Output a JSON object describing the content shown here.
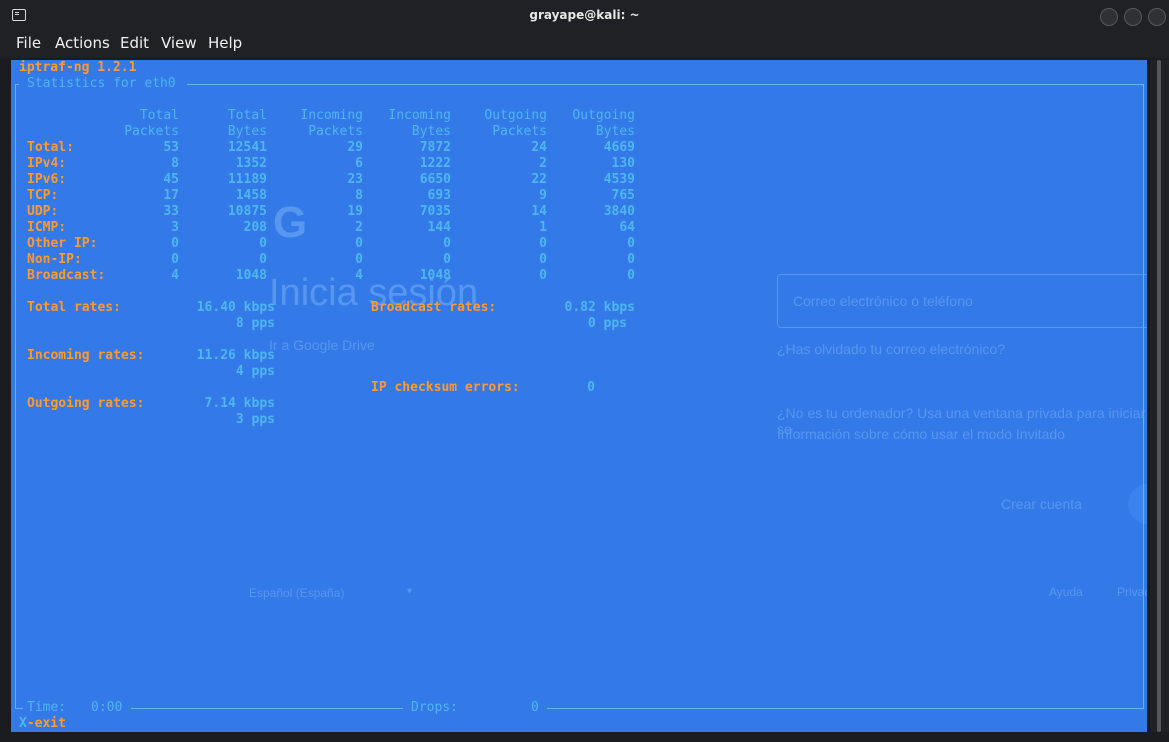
{
  "window": {
    "title": "grayape@kali: ~"
  },
  "menu": [
    "File",
    "Actions",
    "Edit",
    "View",
    "Help"
  ],
  "app": {
    "name": "iptraf-ng 1.2.1",
    "panel_title": "Statistics for eth0"
  },
  "table": {
    "headers": [
      [
        "Total",
        "Packets"
      ],
      [
        "Total",
        "Bytes"
      ],
      [
        "Incoming",
        "Packets"
      ],
      [
        "Incoming",
        "Bytes"
      ],
      [
        "Outgoing",
        "Packets"
      ],
      [
        "Outgoing",
        "Bytes"
      ]
    ],
    "rows": [
      {
        "label": "Total:",
        "values": [
          "53",
          "12541",
          "29",
          "7872",
          "24",
          "4669"
        ]
      },
      {
        "label": "IPv4:",
        "values": [
          "8",
          "1352",
          "6",
          "1222",
          "2",
          "130"
        ]
      },
      {
        "label": "IPv6:",
        "values": [
          "45",
          "11189",
          "23",
          "6650",
          "22",
          "4539"
        ]
      },
      {
        "label": "TCP:",
        "values": [
          "17",
          "1458",
          "8",
          "693",
          "9",
          "765"
        ]
      },
      {
        "label": "UDP:",
        "values": [
          "33",
          "10875",
          "19",
          "7035",
          "14",
          "3840"
        ]
      },
      {
        "label": "ICMP:",
        "values": [
          "3",
          "208",
          "2",
          "144",
          "1",
          "64"
        ]
      },
      {
        "label": "Other IP:",
        "values": [
          "0",
          "0",
          "0",
          "0",
          "0",
          "0"
        ]
      },
      {
        "label": "Non-IP:",
        "values": [
          "0",
          "0",
          "0",
          "0",
          "0",
          "0"
        ]
      },
      {
        "label": "Broadcast:",
        "values": [
          "4",
          "1048",
          "4",
          "1048",
          "0",
          "0"
        ]
      }
    ]
  },
  "rates": {
    "total_label": "Total rates:",
    "total_kbps": "16.40 kbps",
    "total_pps": "8 pps",
    "broadcast_label": "Broadcast rates:",
    "broadcast_kbps": "0.82 kbps",
    "broadcast_pps": "0 pps",
    "incoming_label": "Incoming rates:",
    "incoming_kbps": "11.26 kbps",
    "incoming_pps": "4 pps",
    "checksum_label": "IP checksum errors:",
    "checksum_value": "0",
    "outgoing_label": "Outgoing rates:",
    "outgoing_kbps": "7.14 kbps",
    "outgoing_pps": "3 pps"
  },
  "footer": {
    "time_label": "Time:",
    "time_value": "0:00",
    "drops_label": "Drops:",
    "drops_value": "0",
    "exit_key": "X",
    "exit_text": "-exit"
  },
  "background": {
    "g_logo": "G",
    "heading": "Inicia sesión",
    "subheading": "Ir a Google Drive",
    "email_placeholder": "Correo electrónico o teléfono",
    "forgot": "¿Has olvidado tu correo electrónico?",
    "private_1": "¿No es tu ordenador? Usa una ventana privada para iniciar se",
    "private_2": "Información sobre cómo usar el modo Invitado",
    "create": "Crear cuenta",
    "language": "Español (España)",
    "help": "Ayuda",
    "privacy": "Privacida"
  },
  "colors": {
    "terminal_bg": "#3479e8",
    "label": "#ff9a2e",
    "value": "#4fb6f4"
  }
}
